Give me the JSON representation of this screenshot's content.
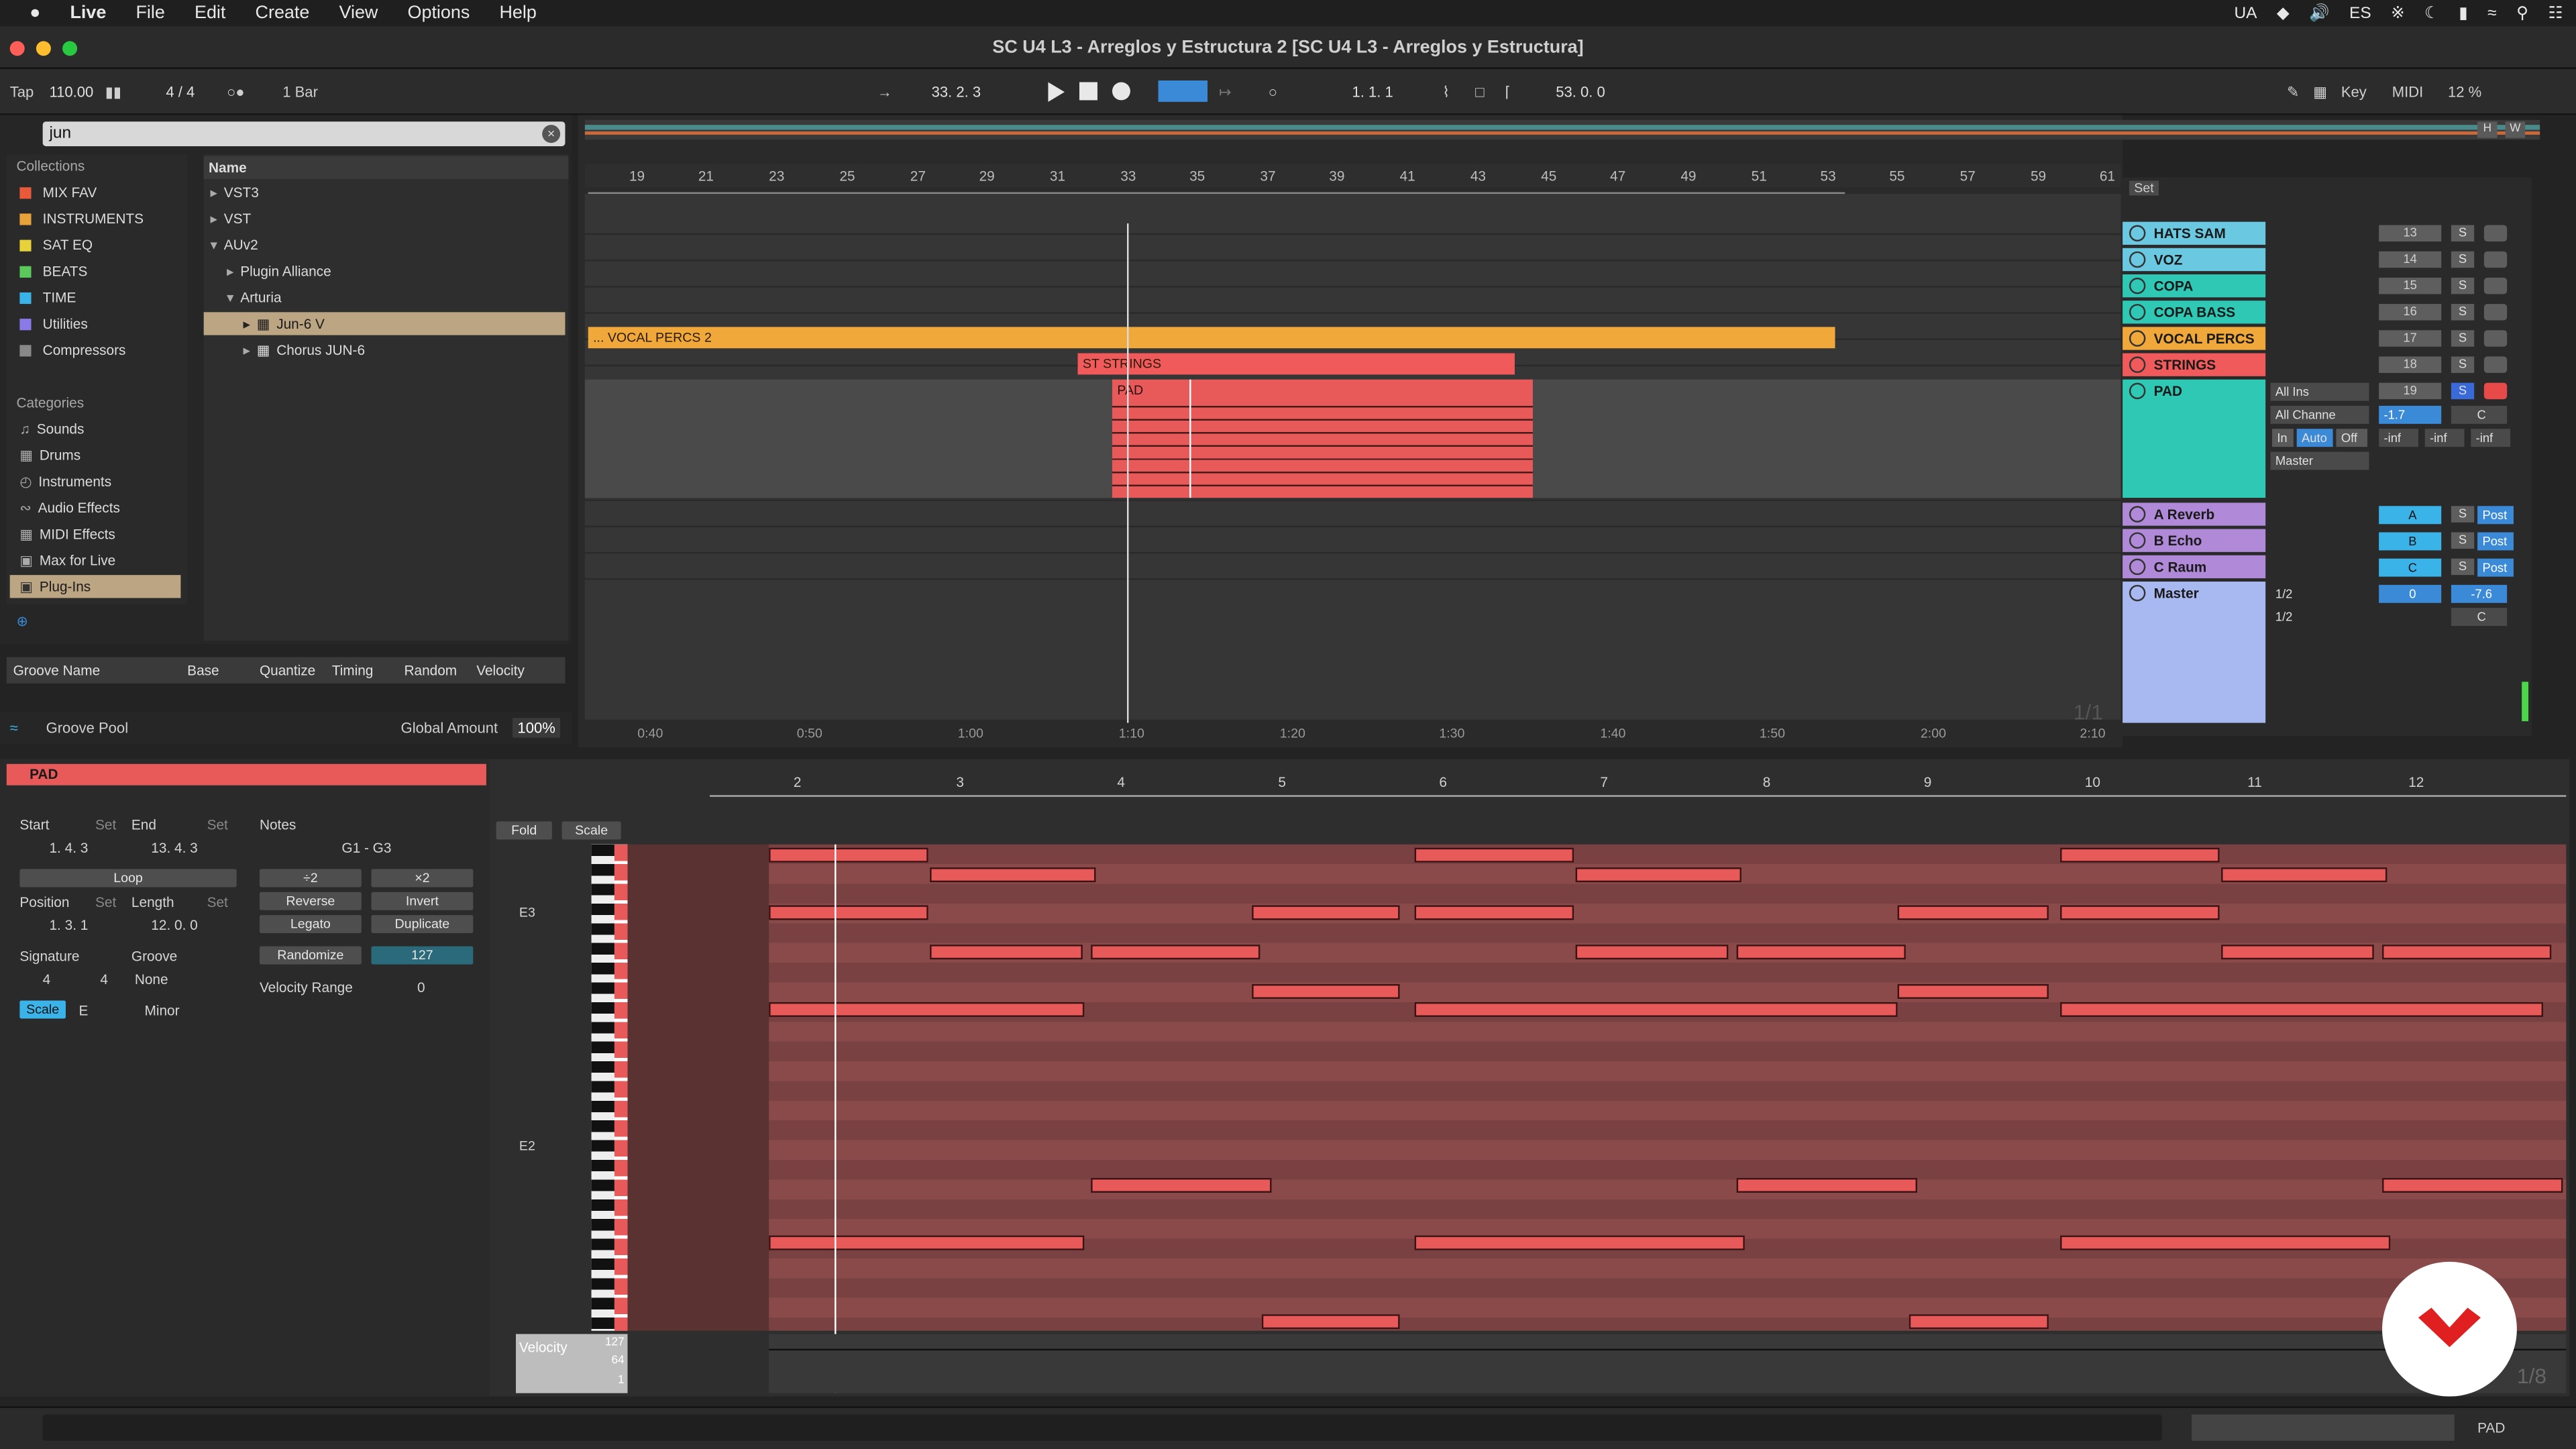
{
  "menubar": {
    "app": "Live",
    "items": [
      "File",
      "Edit",
      "Create",
      "View",
      "Options",
      "Help"
    ],
    "status_items": [
      "UA",
      "ES"
    ]
  },
  "window": {
    "title": "SC U4 L3 - Arreglos y Estructura 2  [SC U4 L3 - Arreglos y Estructura]"
  },
  "control_bar": {
    "tap": "Tap",
    "tempo": "110.00",
    "signature": "4 / 4",
    "quantize": "1 Bar",
    "arrangement_position": "33.  2.  3",
    "loop_start": "1.  1.  1",
    "loop_length": "53.  0.  0",
    "key_label": "Key",
    "midi_label": "MIDI",
    "cpu": "12 %"
  },
  "browser": {
    "search_value": "jun",
    "collections_header": "Collections",
    "collections": [
      {
        "label": "MIX FAV",
        "color": "#e85a3a"
      },
      {
        "label": "INSTRUMENTS",
        "color": "#e8a23a"
      },
      {
        "label": "SAT EQ",
        "color": "#e8d23a"
      },
      {
        "label": "BEATS",
        "color": "#5ac85a"
      },
      {
        "label": "TIME",
        "color": "#3ab4e8"
      },
      {
        "label": "Utilities",
        "color": "#8a7ae8"
      },
      {
        "label": "Compressors",
        "color": "#888888"
      }
    ],
    "categories_header": "Categories",
    "categories": [
      "Sounds",
      "Drums",
      "Instruments",
      "Audio Effects",
      "MIDI Effects",
      "Max for Live",
      "Plug-Ins"
    ],
    "name_header": "Name",
    "tree": [
      "VST3",
      "VST",
      "AUv2",
      "Plugin Alliance",
      "Arturia",
      "Jun-6 V",
      "Chorus JUN-6"
    ]
  },
  "groove": {
    "headers": [
      "Groove Name",
      "Base",
      "Quantize",
      "Timing",
      "Random",
      "Velocity"
    ],
    "pool_label": "Groove Pool",
    "global_amount_label": "Global Amount",
    "global_amount": "100%"
  },
  "arrangement": {
    "bar_numbers": [
      "19",
      "21",
      "23",
      "25",
      "27",
      "29",
      "31",
      "33",
      "35",
      "37",
      "39",
      "41",
      "43",
      "45",
      "47",
      "49",
      "51",
      "53",
      "55",
      "57",
      "59",
      "61"
    ],
    "clips": {
      "vocal_percs": "... VOCAL PERCS 2",
      "strings": "ST STRINGS",
      "pad": "PAD"
    },
    "time_labels": [
      "0:40",
      "0:50",
      "1:00",
      "1:10",
      "1:20",
      "1:30",
      "1:40",
      "1:50",
      "2:00",
      "2:10"
    ],
    "zoom_label": "1/1",
    "set_label": "Set",
    "hw_buttons": [
      "H",
      "W"
    ]
  },
  "tracks": [
    {
      "name": "HATS SAM BOJO",
      "num": "13",
      "color": "#6ac8e0"
    },
    {
      "name": "VOZ",
      "num": "14",
      "color": "#6ac8e0"
    },
    {
      "name": "COPA",
      "num": "15",
      "color": "#2ec8b4"
    },
    {
      "name": "COPA BASS",
      "num": "16",
      "color": "#2ec8b4"
    },
    {
      "name": "VOCAL PERCS",
      "num": "17",
      "color": "#f0a83a"
    },
    {
      "name": "STRINGS",
      "num": "18",
      "color": "#f05a5a"
    },
    {
      "name": "PAD",
      "num": "19",
      "color": "#2ec8b4"
    },
    {
      "name": "A Reverb",
      "color": "#b08ad8"
    },
    {
      "name": "B Echo",
      "color": "#b08ad8"
    },
    {
      "name": "C Raum",
      "color": "#b08ad8"
    },
    {
      "name": "Master",
      "color": "#a8b8f0"
    }
  ],
  "pad_io": {
    "input": "All Ins",
    "channel": "All Channe",
    "monitor": [
      "In",
      "Auto",
      "Off"
    ],
    "output": "Master",
    "volume": "-1.7",
    "pan": "C",
    "meters": [
      "-inf",
      "-inf",
      "-inf"
    ],
    "solo": "S"
  },
  "returns": {
    "sends": [
      "A",
      "B",
      "C"
    ],
    "post": "Post",
    "master_cue": "1/2",
    "master_out": "1/2",
    "master_vol": "0",
    "master_db": "-7.6",
    "master_pan": "C"
  },
  "clip_view": {
    "clip_name": "PAD",
    "start_label": "Start",
    "end_label": "End",
    "set_label": "Set",
    "start": "1.   4.   3",
    "end": "13.   4.   3",
    "loop_label": "Loop",
    "position_label": "Position",
    "length_label": "Length",
    "position": "1.   3.   1",
    "length": "12.   0.   0",
    "signature_label": "Signature",
    "groove_label": "Groove",
    "sig_num": "4",
    "sig_den": "4",
    "groove_value": "None",
    "scale_label": "Scale",
    "scale_root": "E",
    "scale_mode": "Minor",
    "notes_label": "Notes",
    "notes_range": "G1 - G3",
    "div2": "÷2",
    "mul2": "×2",
    "reverse": "Reverse",
    "invert": "Invert",
    "legato": "Legato",
    "duplicate": "Duplicate",
    "randomize": "Randomize",
    "randomize_value": "127",
    "velocity_range_label": "Velocity Range",
    "velocity_range": "0"
  },
  "piano_roll": {
    "fold": "Fold",
    "scale": "Scale",
    "bars": [
      "2",
      "3",
      "4",
      "5",
      "6",
      "7",
      "8",
      "9",
      "10",
      "11",
      "12"
    ],
    "key_labels": [
      "E3",
      "E2"
    ],
    "velocity_label": "Velocity",
    "vel_ticks": [
      "127",
      "64",
      "1"
    ],
    "zoom_label": "1/8"
  },
  "bottom": {
    "track_label": "PAD"
  }
}
